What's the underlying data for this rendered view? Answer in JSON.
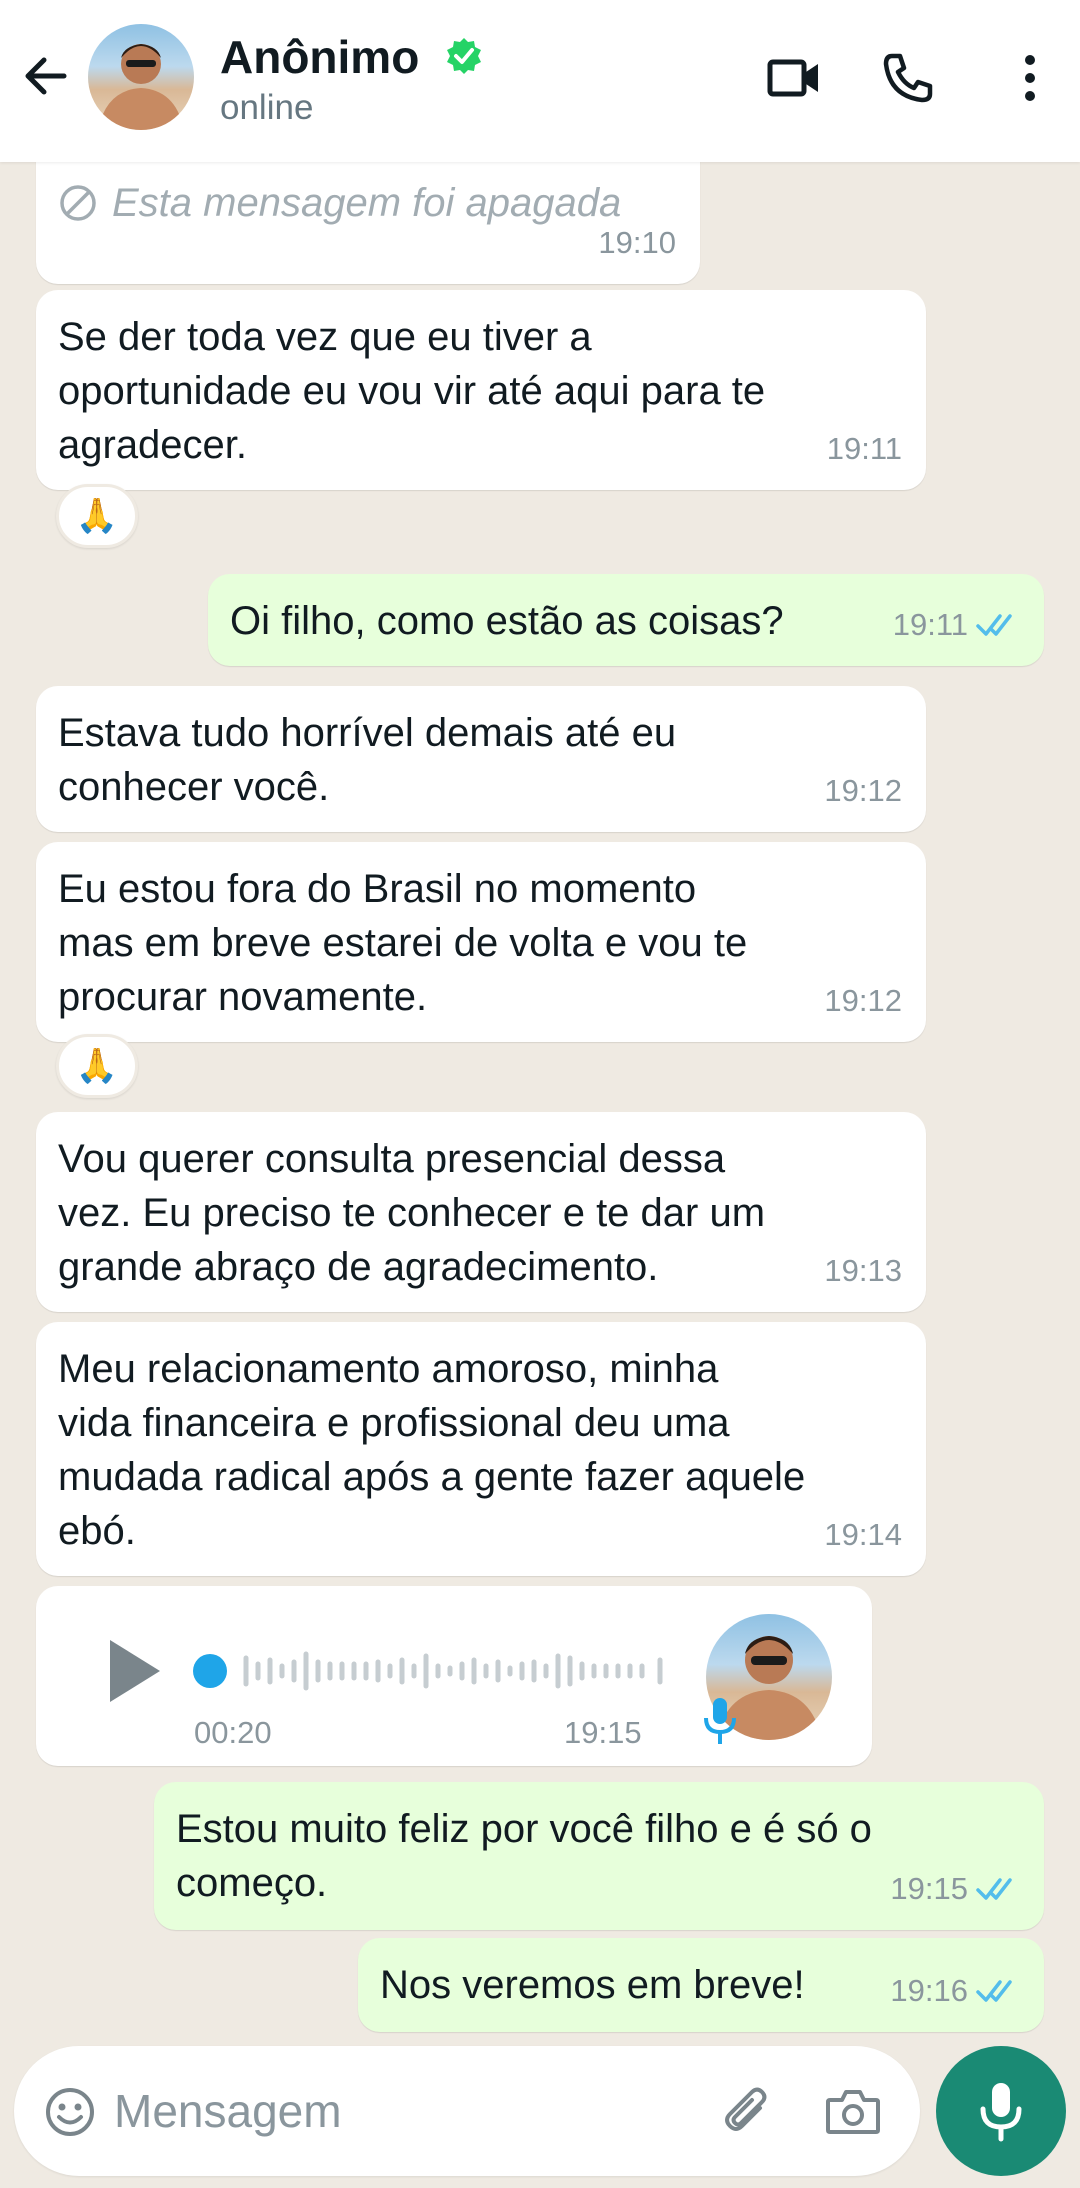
{
  "header": {
    "name": "Anônimo",
    "status": "online",
    "back_icon": "arrow-left-icon",
    "video_icon": "video-call-icon",
    "call_icon": "phone-icon",
    "menu_icon": "more-vertical-icon",
    "verified_color": "#25d366"
  },
  "messages": {
    "m0": {
      "text": "Esta mensagem foi apagada",
      "time": "19:10"
    },
    "m1": {
      "text": "Se der toda vez que eu tiver a\noportunidade eu vou vir até aqui para te\nagradecer.",
      "time": "19:11",
      "reaction": "🙏"
    },
    "m2": {
      "text": "Oi filho, como estão as coisas?",
      "time": "19:11"
    },
    "m3": {
      "text": "Estava tudo horrível demais até eu\nconhecer você.",
      "time": "19:12"
    },
    "m4": {
      "text": "Eu estou fora do Brasil no momento\nmas em breve estarei de volta e vou te\nprocurar novamente.",
      "time": "19:12",
      "reaction": "🙏"
    },
    "m5": {
      "text": "Vou querer consulta presencial dessa\nvez. Eu preciso te conhecer e te dar um\ngrande abraço de agradecimento.",
      "time": "19:13"
    },
    "m6": {
      "text": "Meu relacionamento amoroso, minha\nvida financeira e profissional deu uma\nmudada radical após a gente fazer aquele\nebó.",
      "time": "19:14"
    },
    "m7": {
      "type": "audio",
      "duration": "00:20",
      "time": "19:15",
      "progress": 0
    },
    "m8": {
      "text": "Estou muito feliz por você filho e é só o\ncomeço.",
      "time": "19:15"
    },
    "m9": {
      "text": "Nos veremos em breve!",
      "time": "19:16"
    }
  },
  "input": {
    "placeholder": "Mensagem",
    "emoji_icon": "emoji-icon",
    "attach_icon": "paperclip-icon",
    "camera_icon": "camera-icon",
    "mic_icon": "microphone-icon"
  },
  "colors": {
    "incoming": "#ffffff",
    "outgoing": "#e7ffdb",
    "read_ticks": "#53bdeb",
    "accent": "#1a8a74",
    "background": "#efeae2"
  }
}
